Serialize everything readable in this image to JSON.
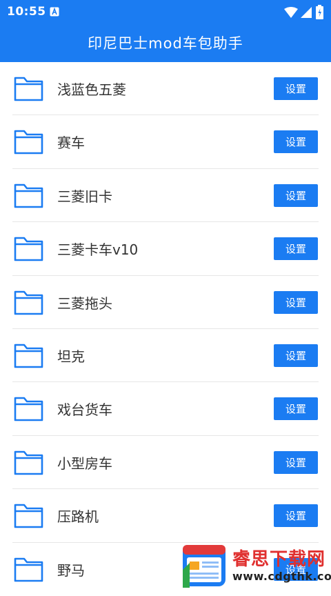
{
  "status_bar": {
    "time": "10:55",
    "icons": [
      "app-notification-icon",
      "wifi-icon",
      "signal-icon",
      "battery-icon"
    ]
  },
  "app_bar": {
    "title": "印尼巴士mod车包助手"
  },
  "colors": {
    "accent": "#1b7cf2",
    "folder": "#1b7cf2",
    "text": "#333333",
    "divider": "#e6e6e6"
  },
  "items": [
    {
      "label": "浅蓝色五菱",
      "button": "设置"
    },
    {
      "label": "赛车",
      "button": "设置"
    },
    {
      "label": "三菱旧卡",
      "button": "设置"
    },
    {
      "label": "三菱卡车v10",
      "button": "设置"
    },
    {
      "label": "三菱拖头",
      "button": "设置"
    },
    {
      "label": "坦克",
      "button": "设置"
    },
    {
      "label": "戏台货车",
      "button": "设置"
    },
    {
      "label": "小型房车",
      "button": "设置"
    },
    {
      "label": "压路机",
      "button": "设置"
    },
    {
      "label": "野马",
      "button": "设置"
    }
  ],
  "watermark": {
    "title": "睿思下载网",
    "url": "www.cdgthk.com"
  }
}
